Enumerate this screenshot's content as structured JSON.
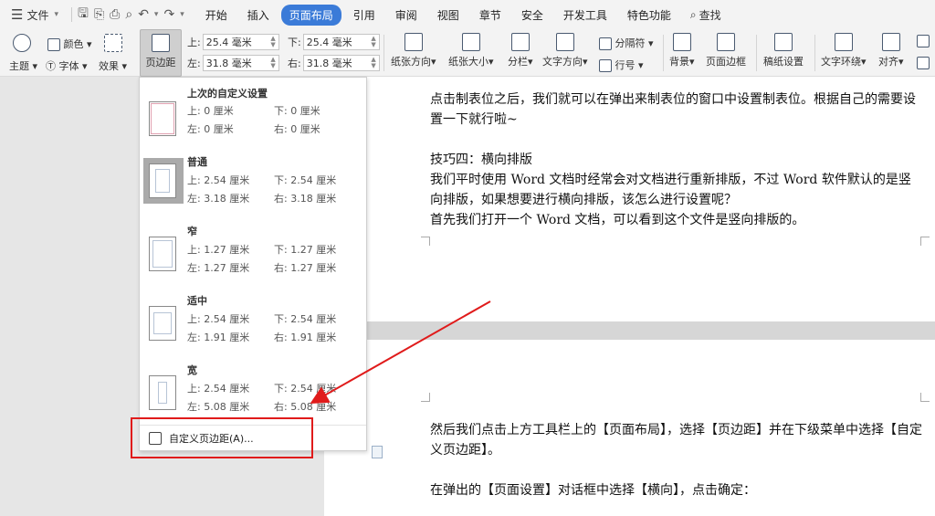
{
  "menubar": {
    "file_label": "文件",
    "tabs": [
      "开始",
      "插入",
      "页面布局",
      "引用",
      "审阅",
      "视图",
      "章节",
      "安全",
      "开发工具",
      "特色功能"
    ],
    "active_tab": "页面布局",
    "search_label": "查找"
  },
  "ribbon": {
    "theme_label": "主题",
    "color_label": "颜色",
    "font_label": "字体",
    "effect_label": "效果",
    "margin_label": "页边距",
    "top_label": "上:",
    "top_value": "25.4 毫米",
    "bottom_label": "下:",
    "bottom_value": "25.4 毫米",
    "left_label": "左:",
    "left_value": "31.8 毫米",
    "right_label": "右:",
    "right_value": "31.8 毫米",
    "orientation_label": "纸张方向",
    "size_label": "纸张大小",
    "columns_label": "分栏",
    "text_direction_label": "文字方向",
    "break_label": "分隔符",
    "line_number_label": "行号",
    "background_label": "背景",
    "page_border_label": "页面边框",
    "manuscript_label": "稿纸设置",
    "text_wrap_label": "文字环绕",
    "align_label": "对齐"
  },
  "dropdown": {
    "items": [
      {
        "name": "上次的自定义设置",
        "top": "上: 0 厘米",
        "bottom": "下: 0 厘米",
        "left": "左: 0 厘米",
        "right": "右: 0 厘米"
      },
      {
        "name": "普通",
        "top": "上: 2.54 厘米",
        "bottom": "下: 2.54 厘米",
        "left": "左: 3.18 厘米",
        "right": "右: 3.18 厘米"
      },
      {
        "name": "窄",
        "top": "上: 1.27 厘米",
        "bottom": "下: 1.27 厘米",
        "left": "左: 1.27 厘米",
        "right": "右: 1.27 厘米"
      },
      {
        "name": "适中",
        "top": "上: 2.54 厘米",
        "bottom": "下: 2.54 厘米",
        "left": "左: 1.91 厘米",
        "right": "右: 1.91 厘米"
      },
      {
        "name": "宽",
        "top": "上: 2.54 厘米",
        "bottom": "下: 2.54 厘米",
        "left": "左: 5.08 厘米",
        "right": "右: 5.08 厘米"
      }
    ],
    "custom_label": "自定义页边距(A)..."
  },
  "document": {
    "page1": [
      "点击制表位之后，我们就可以在弹出来制表位的窗口中设置制表位。根据自己的需要设置一下就行啦~",
      "",
      "技巧四：横向排版",
      "我们平时使用 Word 文档时经常会对文档进行重新排版，不过 Word 软件默认的是竖向排版，如果想要进行横向排版，该怎么进行设置呢？",
      "首先我们打开一个 Word 文档，可以看到这个文件是竖向排版的。"
    ],
    "page2": [
      "然后我们点击上方工具栏上的【页面布局】，选择【页边距】并在下级菜单中选择【自定义页边距】。",
      "",
      "在弹出的【页面设置】对话框中选择【横向】，点击确定："
    ]
  },
  "colors": {
    "accent": "#3b7bd8",
    "highlight_box": "#e01b1b",
    "arrow": "#e01b1b"
  }
}
